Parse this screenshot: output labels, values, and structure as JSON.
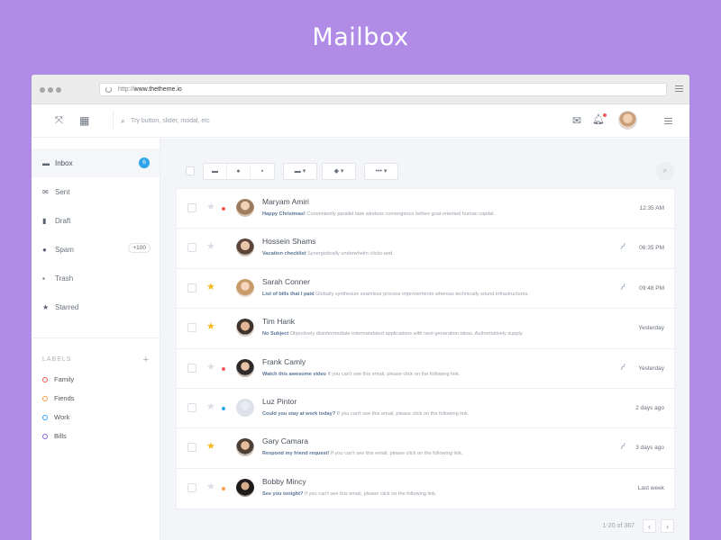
{
  "page_title": "Mailbox",
  "browser": {
    "url_proto": "http://",
    "url_host": "www.thetheme.io"
  },
  "topbar": {
    "search_placeholder": "Try button, slider, modal, etc"
  },
  "sidebar": {
    "items": [
      {
        "label": "Inbox",
        "icon": "inbox-icon",
        "badge": "6"
      },
      {
        "label": "Sent",
        "icon": "envelope-icon"
      },
      {
        "label": "Draft",
        "icon": "file-icon"
      },
      {
        "label": "Spam",
        "icon": "alert-icon",
        "count": "+100"
      },
      {
        "label": "Trash",
        "icon": "trash-icon"
      },
      {
        "label": "Starred",
        "icon": "star-icon"
      }
    ],
    "labels_heading": "LABELS",
    "labels": [
      {
        "label": "Family",
        "color": "#f15b5b"
      },
      {
        "label": "Fiends",
        "color": "#f5a043"
      },
      {
        "label": "Work",
        "color": "#2fa5ec"
      },
      {
        "label": "Bills",
        "color": "#8e5ee0"
      }
    ]
  },
  "emails": [
    {
      "sender": "Maryam Amiri",
      "subject": "Happy Christmas!",
      "snippet": " Conveniently parallel task wireless convergence before goal-oriented human capital.",
      "time": "12:35 AM",
      "starred": false,
      "dot": "#f15b5b",
      "attachment": false
    },
    {
      "sender": "Hossein Shams",
      "subject": "Vacation checklist",
      "snippet": " Synergistically underwhelm clicks-and.",
      "time": "06:35 PM",
      "starred": false,
      "dot": "",
      "attachment": true
    },
    {
      "sender": "Sarah Conner",
      "subject": "List of bills that I paid",
      "snippet": " Globally synthesize seamless process improvements whereas technically sound infrastructures.",
      "time": "09:48 PM",
      "starred": true,
      "dot": "",
      "attachment": true
    },
    {
      "sender": "Tim Hank",
      "subject": "No Subject",
      "snippet": " Objectively disintermediate intermandated applications with next-generation ideas. Authoritatively supply.",
      "time": "Yesterday",
      "starred": true,
      "dot": "",
      "attachment": false
    },
    {
      "sender": "Frank Camly",
      "subject": "Watch this awesome video",
      "snippet": " If you can't see this email, please click on the following link.",
      "time": "Yesterday",
      "starred": false,
      "dot": "#f15b5b",
      "attachment": true
    },
    {
      "sender": "Luz Pintor",
      "subject": "Could you stay at work today?",
      "snippet": " If you can't see this email, please click on the following link.",
      "time": "2 days ago",
      "starred": false,
      "dot": "#2fa5ec",
      "attachment": false
    },
    {
      "sender": "Gary Camara",
      "subject": "Respond my friend request!",
      "snippet": " If you can't see this email, please click on the following link.",
      "time": "3 days ago",
      "starred": true,
      "dot": "",
      "attachment": true
    },
    {
      "sender": "Bobby Mincy",
      "subject": "See you tonight?",
      "snippet": " If you can't see this email, please click on the following link.",
      "time": "Last week",
      "starred": false,
      "dot": "#f5a043",
      "attachment": false
    }
  ],
  "pager": {
    "range": "1-20 of 367"
  }
}
